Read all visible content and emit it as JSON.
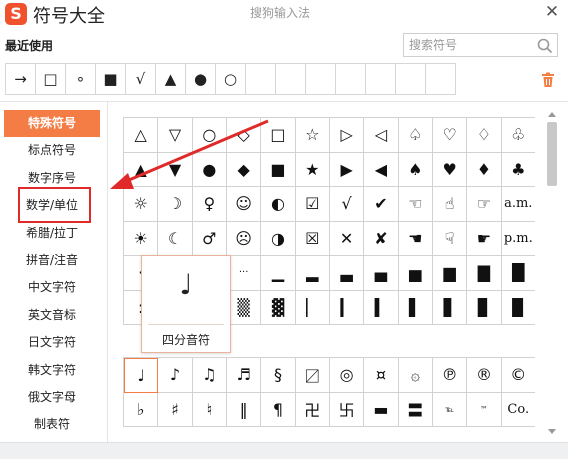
{
  "app": {
    "title": "符号大全",
    "subtitle": "搜狗输入法",
    "logo": "S",
    "close": "✕"
  },
  "recent": {
    "label": "最近使用",
    "symbols": [
      "→",
      "□",
      "∘",
      "■",
      "√",
      "▲",
      "●",
      "○",
      "",
      "",
      "",
      "",
      "",
      "",
      ""
    ]
  },
  "search": {
    "placeholder": "搜索符号"
  },
  "sidebar": {
    "active_index": 0,
    "items": [
      "特殊符号",
      "标点符号",
      "数字序号",
      "数学/单位",
      "希腊/拉丁",
      "拼音/注音",
      "中文字符",
      "英文音标",
      "日文字符",
      "韩文字符",
      "俄文字母",
      "制表符"
    ]
  },
  "grid_top": [
    [
      "△",
      "▽",
      "○",
      "◇",
      "□",
      "☆",
      "▷",
      "◁",
      "♤",
      "♡",
      "♢",
      "♧"
    ],
    [
      "▲",
      "▼",
      "●",
      "◆",
      "■",
      "★",
      "▶",
      "◀",
      "♠",
      "♥",
      "♦",
      "♣"
    ],
    [
      "☼",
      "☽",
      "♀",
      "☺",
      "◐",
      "☑",
      "√",
      "✔",
      "☜",
      "☝",
      "☞",
      "a.m."
    ],
    [
      "☀",
      "☾",
      "♂",
      "☹",
      "◑",
      "☒",
      "✕",
      "✘",
      "☚",
      "☟",
      "☛",
      "p.m."
    ],
    [
      "·",
      "",
      "",
      "···",
      "▁",
      "▂",
      "▃",
      "▄",
      "▅",
      "▆",
      "▇",
      "█"
    ],
    [
      ":",
      "",
      "",
      "▒",
      "▓",
      "▏",
      "▎",
      "▍",
      "▌",
      "▋",
      "▊",
      "▉"
    ]
  ],
  "grid_bottom": [
    [
      "♩",
      "♪",
      "♫",
      "♬",
      "§",
      "〼",
      "◎",
      "¤",
      "۞",
      "℗",
      "®",
      "©"
    ],
    [
      "♭",
      "♯",
      "♮",
      "‖",
      "¶",
      "卍",
      "卐",
      "▬",
      "〓",
      "℡",
      "™",
      "Co."
    ]
  ],
  "tooltip": {
    "glyph": "♩",
    "label": "四分音符"
  },
  "colors": {
    "accent": "#f47d46",
    "highlight": "#e02a2a"
  }
}
